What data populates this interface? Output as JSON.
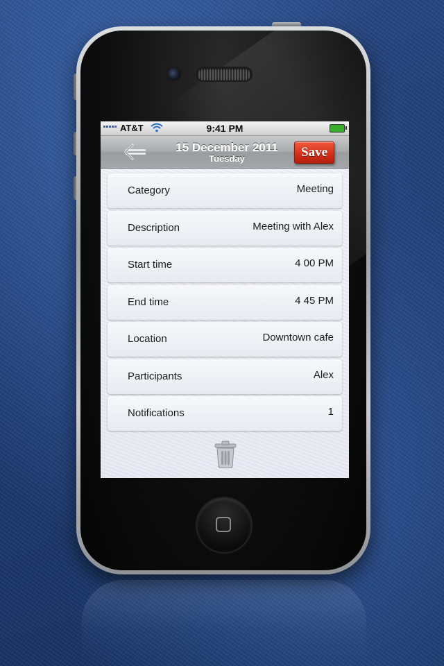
{
  "statusbar": {
    "carrier": "AT&T",
    "time": "9:41 PM",
    "wifi_icon": "wifi-icon",
    "battery_icon": "battery-icon"
  },
  "navbar": {
    "back_icon": "back-arrow-icon",
    "date": "15 December 2011",
    "weekday": "Tuesday",
    "save_label": "Save"
  },
  "event": {
    "fields": [
      {
        "label": "Category",
        "value": "Meeting"
      },
      {
        "label": "Description",
        "value": "Meeting with Alex"
      },
      {
        "label": "Start time",
        "value": "4 00 PM"
      },
      {
        "label": "End time",
        "value": "4 45 PM"
      },
      {
        "label": "Location",
        "value": "Downtown cafe"
      },
      {
        "label": "Participants",
        "value": "Alex"
      },
      {
        "label": "Notifications",
        "value": "1"
      }
    ]
  },
  "footer": {
    "delete_icon": "trash-icon"
  },
  "colors": {
    "save_button": "#d3311a",
    "navbar": "#a9aaad",
    "background_blue": "#1e3b73"
  }
}
